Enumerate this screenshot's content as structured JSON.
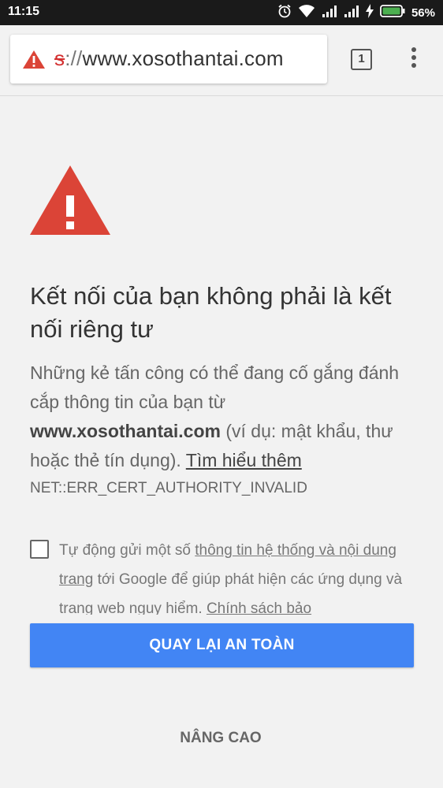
{
  "status_bar": {
    "time": "11:15",
    "battery_percent": "56%",
    "icons": [
      "alarm-icon",
      "wifi-icon",
      "signal-icon",
      "signal-icon",
      "charging-icon",
      "battery-icon"
    ]
  },
  "toolbar": {
    "url_scheme": "s",
    "url_separator": "://",
    "url_host": "www.xosothantai.com",
    "tab_count": "1"
  },
  "interstitial": {
    "heading": "Kết nối của bạn không phải là kết nối riêng tư",
    "description_prefix": "Những kẻ tấn công có thể đang cố gắng đánh cắp thông tin của bạn từ ",
    "description_host": "www.xosothantai.com",
    "description_suffix": " (ví dụ: mật khẩu, thư hoặc thẻ tín dụng). ",
    "learn_more": "Tìm hiểu thêm",
    "error_code": "NET::ERR_CERT_AUTHORITY_INVALID",
    "report_prefix": "Tự động gửi một số ",
    "report_link": "thông tin hệ thống và nội dung trang",
    "report_middle": " tới Google để giúp phát hiện các ứng dụng và trang web nguy hiểm. ",
    "report_policy": "Chính sách bảo",
    "report_checked": false,
    "back_button": "QUAY LẠI AN TOÀN",
    "advanced_button": "NÂNG CAO"
  },
  "colors": {
    "warning_red": "#db4437",
    "primary_blue": "#4285f4",
    "battery_green": "#4caf50"
  }
}
